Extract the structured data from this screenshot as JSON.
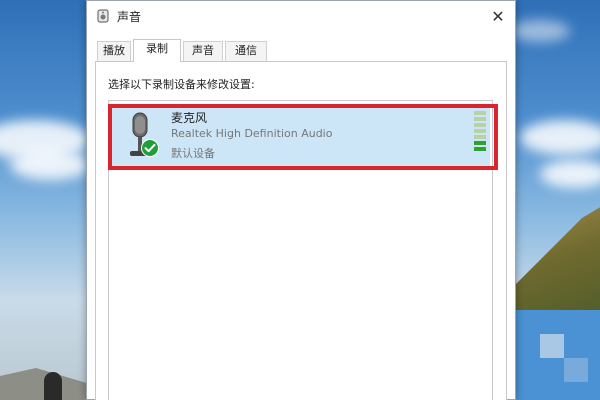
{
  "window": {
    "title": "声音",
    "close_label": "✕"
  },
  "tabs": [
    {
      "label": "播放",
      "active": false
    },
    {
      "label": "录制",
      "active": true
    },
    {
      "label": "声音",
      "active": false
    },
    {
      "label": "通信",
      "active": false
    }
  ],
  "recording": {
    "instruction": "选择以下录制设备来修改设置:",
    "devices": [
      {
        "name": "麦克风",
        "driver": "Realtek High Definition Audio",
        "status": "默认设备",
        "icon": "microphone-icon",
        "default_badge_icon": "green-check-icon",
        "selected": true,
        "level_fraction": 0.3
      }
    ]
  },
  "colors": {
    "selection_bg": "#cde6f7",
    "highlight_border": "#d9252d",
    "level_on": "#2ea12e",
    "check_green": "#1f9e3a"
  }
}
